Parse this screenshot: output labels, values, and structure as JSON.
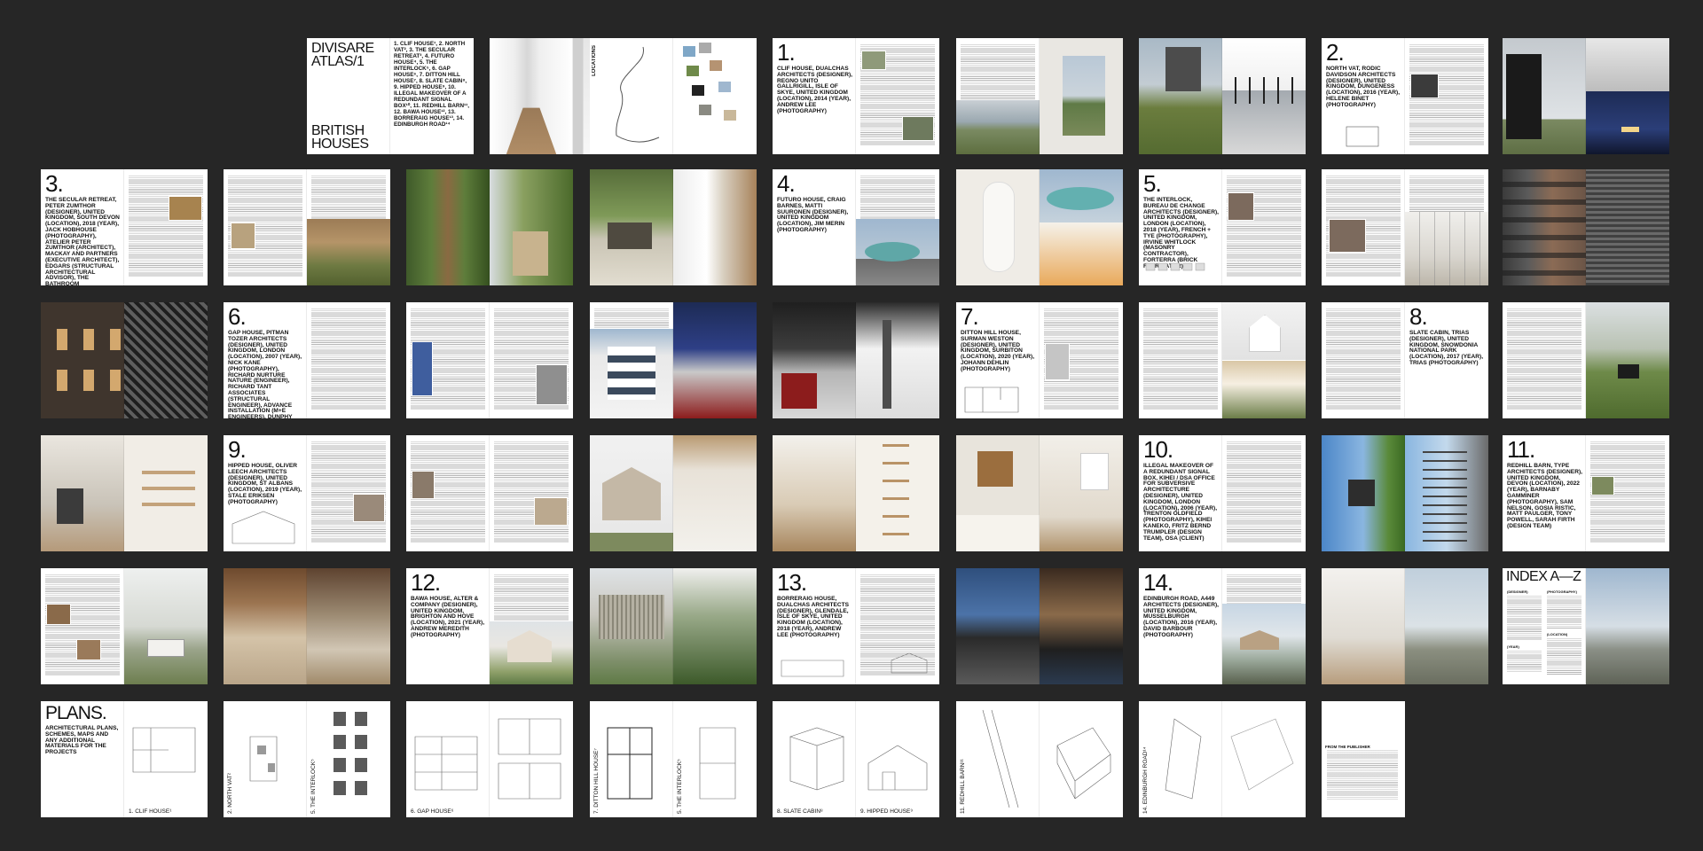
{
  "background": "#262626",
  "cover": {
    "title": "DIVISARE\nATLAS/1",
    "subtitle": "BRITISH\nHOUSES",
    "contents": "1. CLIF HOUSE¹, 2. NORTH VAT², 3. THE SECULAR RETREAT³, 4. FUTURO HOUSE⁴, 5. THE INTERLOCK⁵, 6. GAP HOUSE⁶, 7. DITTON HILL HOUSE⁷, 8. SLATE CABIN⁸, 9. HIPPED HOUSE⁹, 10. ILLEGAL MAKEOVER OF A REDUNDANT SIGNAL BOX¹⁰, 11. REDHILL BARN¹¹, 12. BAWA HOUSE¹², 13. BORRERAIG HOUSE¹³, 14. EDINBURGH ROAD¹⁴"
  },
  "locations_label": "LOCATIONS",
  "projects": [
    {
      "number": "1.",
      "caption": "CLIF HOUSE, DUALCHAS ARCHITECTS (DESIGNER), REGNO UNITO GALLRIGILL, ISLE OF SKYE, UNITED KINGDOM (LOCATION), 2014 (YEAR), ANDREW LEE (PHOTOGRAPHY)"
    },
    {
      "number": "2.",
      "caption": "NORTH VAT, RODIC DAVIDSON ARCHITECTS (DESIGNER), UNITED KINGDOM, DUNGENESS (LOCATION), 2016 (YEAR), HELENE BINET (PHOTOGRAPHY)"
    },
    {
      "number": "3.",
      "caption": "THE SECULAR RETREAT, PETER ZUMTHOR (DESIGNER), UNITED KINGDOM, SOUTH DEVON (LOCATION), 2018 (YEAR), JACK HOBHOUSE (PHOTOGRAPHY), ATELIER PETER ZUMTHOR (ARCHITECT), MACKAY AND PARTNERS (EXECUTIVE ARCHITECT), EDGARS (STRUCTURAL ARCHITECTURAL ADVISOR), THE BATHROOM PARTNERSHIP (LANDSCAPE), JANE WERNICK ASSOCIATES (STRUCTURES)"
    },
    {
      "number": "4.",
      "caption": "FUTURO HOUSE, CRAIG BARNES, MATTI SUURONEN (DESIGNER), UNITED KINGDOM (LOCATION), JIM MERIN (PHOTOGRAPHY)"
    },
    {
      "number": "5.",
      "caption": "THE INTERLOCK, BUREAU DE CHANGE ARCHITECTS (DESIGNER), UNITED KINGDOM, LONDON (LOCATION), 2018 (YEAR), FRENCH + TYE (PHOTOGRAPHY), IRVINE WHITLOCK (MASONRY CONTRACTOR), FORTERRA (BRICK FABRICATOR)"
    },
    {
      "number": "6.",
      "caption": "GAP HOUSE, PITMAN TOZER ARCHITECTS (DESIGNER), UNITED KINGDOM, LONDON (LOCATION), 2007 (YEAR), NICK KANE (PHOTOGRAPHY), RICHARD NURTURE NATURE (ENGINEER), RICHARD TANT ASSOCIATES (STRUCTURAL ENGINEER), ADVANCE INSTALLATION (M+E ENGINEERS), DUNPHY HAYES, PARTY WALL SURVEYOR, CLEVELAND CONSTRUCTION LTD (MAIN CONTRACTOR)"
    },
    {
      "number": "7.",
      "caption": "DITTON HILL HOUSE, SURMAN WESTON (DESIGNER), UNITED KINGDOM, SURBITON (LOCATION), 2020 (YEAR), JOHANN DEHLIN (PHOTOGRAPHY)"
    },
    {
      "number": "8.",
      "caption": "SLATE CABIN, TRIAS (DESIGNER), UNITED KINGDOM, SNOWDONIA NATIONAL PARK (LOCATION), 2017 (YEAR), TRIAS (PHOTOGRAPHY)"
    },
    {
      "number": "9.",
      "caption": "HIPPED HOUSE, OLIVER LEECH ARCHITECTS (DESIGNER), UNITED KINGDOM, ST ALBANS (LOCATION), 2019 (YEAR), STALE ERIKSEN (PHOTOGRAPHY)"
    },
    {
      "number": "10.",
      "caption": "ILLEGAL MAKEOVER OF A REDUNDANT SIGNAL BOX, KIHEI / DSA OFFICE FOR SUBVERSIVE ARCHITECTURE (DESIGNER), UNITED KINGDOM, LONDON (LOCATION), 2006 (YEAR), TRENTON OLDFIELD (PHOTOGRAPHY), KIHEI KANEKO, FRITZ BERND TRUMPLER (DESIGN TEAM), OSA (CLIENT)"
    },
    {
      "number": "11.",
      "caption": "REDHILL BARN, TYPE ARCHITECTS (DESIGNER), UNITED KINGDOM, DEVON (LOCATION), 2022 (YEAR), BARNABY GAMMINER (PHOTOGRAPHY), SAM NELSON, GOSIA RISTIC, MATT PAULGER, TONY POWELL, SARAH FIRTH (DESIGN TEAM)"
    },
    {
      "number": "12.",
      "caption": "BAWA HOUSE, ALTER & COMPANY (DESIGNER), UNITED KINGDOM, BRIGHTON AND HOVE (LOCATION), 2021 (YEAR), ANDREW MEREDITH (PHOTOGRAPHY)"
    },
    {
      "number": "13.",
      "caption": "BORRERAIG HOUSE, DUALCHAS ARCHITECTS (DESIGNER), GLENDALE, ISLE OF SKYE, UNITED KINGDOM (LOCATION), 2018 (YEAR), ANDREW LEE (PHOTOGRAPHY)"
    },
    {
      "number": "14.",
      "caption": "EDINBURGH ROAD, A449 ARCHITECTS (DESIGNER), UNITED KINGDOM, MUSSELBURGH (LOCATION), 2016 (YEAR), DAVID BARBOUR (PHOTOGRAPHY)"
    }
  ],
  "index": {
    "title": "INDEX A—Z",
    "designers_label": "(DESIGNER)",
    "photography_label": "(PHOTOGRAPHY)",
    "location_label": "(LOCATION)",
    "year_label": "(YEAR)"
  },
  "plans": {
    "title": "PLANS.",
    "subtitle": "ARCHITECTURAL PLANS, SCHEMES, MAPS AND ANY ADDITIONAL MATERIALS FOR THE PROJECTS",
    "labels": [
      "1. CLIF HOUSE¹",
      "2. NORTH VAT²",
      "5. THE INTERLOCK⁵",
      "6. GAP HOUSE⁶",
      "7. DITTON HILL HOUSE⁷",
      "5. THE INTERLOCK⁵",
      "8. SLATE CABIN⁸",
      "9. HIPPED HOUSE⁹",
      "11. REDHILL BARN¹¹",
      "14. EDINBURGH ROAD¹⁴"
    ]
  },
  "publisher_label": "FROM THE PUBLISHER",
  "colors": {
    "sky": "#9fb7cf",
    "grass": "#6f8a4a",
    "wood": "#a9825a",
    "concrete": "#c8c6c0",
    "night": "#1d2b55",
    "brick": "#7c6a5d"
  }
}
